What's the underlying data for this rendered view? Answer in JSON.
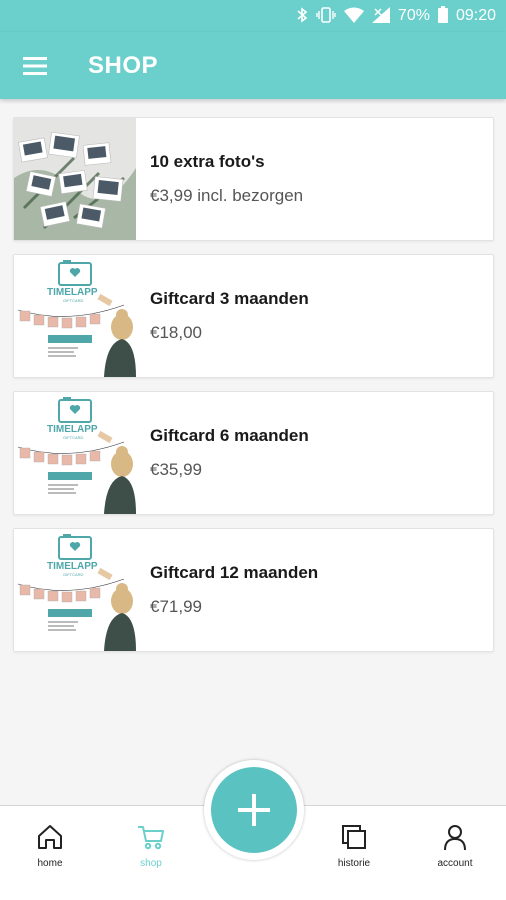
{
  "statusbar": {
    "battery": "70%",
    "time": "09:20",
    "icons": [
      "bluetooth-icon",
      "vibrate-icon",
      "wifi-icon",
      "signal-icon",
      "battery-icon"
    ]
  },
  "appbar": {
    "title": "SHOP",
    "menu_icon": "menu-icon",
    "color": "#6bcfcc"
  },
  "products": [
    {
      "title": "10 extra foto's",
      "price": "€3,99 incl. bezorgen",
      "image": "photos"
    },
    {
      "title": "Giftcard 3 maanden",
      "price": "€18,00",
      "image": "giftcard",
      "brand": "TIMELAPP",
      "sub": "GIFTCARD"
    },
    {
      "title": "Giftcard 6 maanden",
      "price": "€35,99",
      "image": "giftcard",
      "brand": "TIMELAPP",
      "sub": "GIFTCARD"
    },
    {
      "title": "Giftcard 12 maanden",
      "price": "€71,99",
      "image": "giftcard",
      "brand": "TIMELAPP",
      "sub": "GIFTCARD"
    }
  ],
  "nav": {
    "home": "home",
    "shop": "shop",
    "history": "historie",
    "account": "account",
    "active": "shop"
  },
  "fab": {
    "icon": "plus-icon",
    "color": "#5ac3c1"
  }
}
